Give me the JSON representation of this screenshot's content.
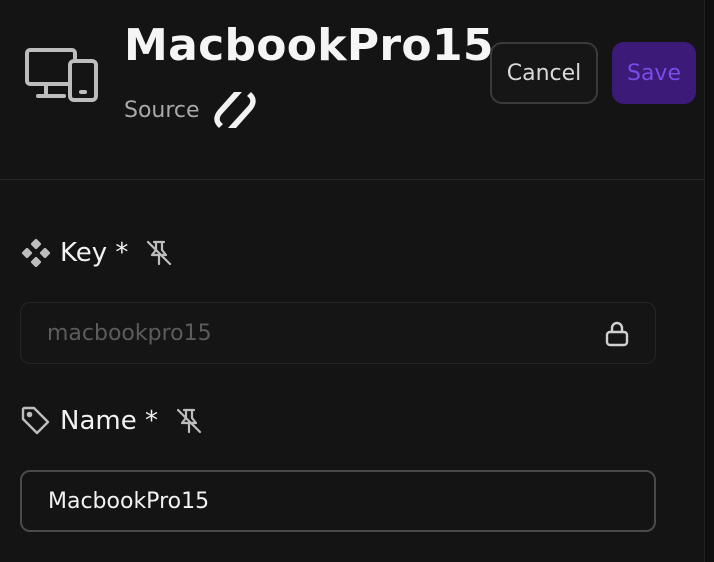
{
  "header": {
    "title": "MacbookPro15",
    "source_label": "Source",
    "device_icon": "devices-icon",
    "source_logo_icon": "source-logo-icon"
  },
  "actions": {
    "cancel_label": "Cancel",
    "save_label": "Save"
  },
  "fields": {
    "key": {
      "label": "Key *",
      "icon": "key-diamond-icon",
      "pin_icon": "pin-off-icon",
      "value": "macbookpro15",
      "locked": true,
      "lock_icon": "lock-icon"
    },
    "name": {
      "label": "Name *",
      "icon": "tag-icon",
      "pin_icon": "pin-off-icon",
      "value": "MacbookPro15"
    }
  },
  "colors": {
    "background": "#141414",
    "save_button_bg": "#3b1a78",
    "save_button_text": "#7a4be8"
  }
}
